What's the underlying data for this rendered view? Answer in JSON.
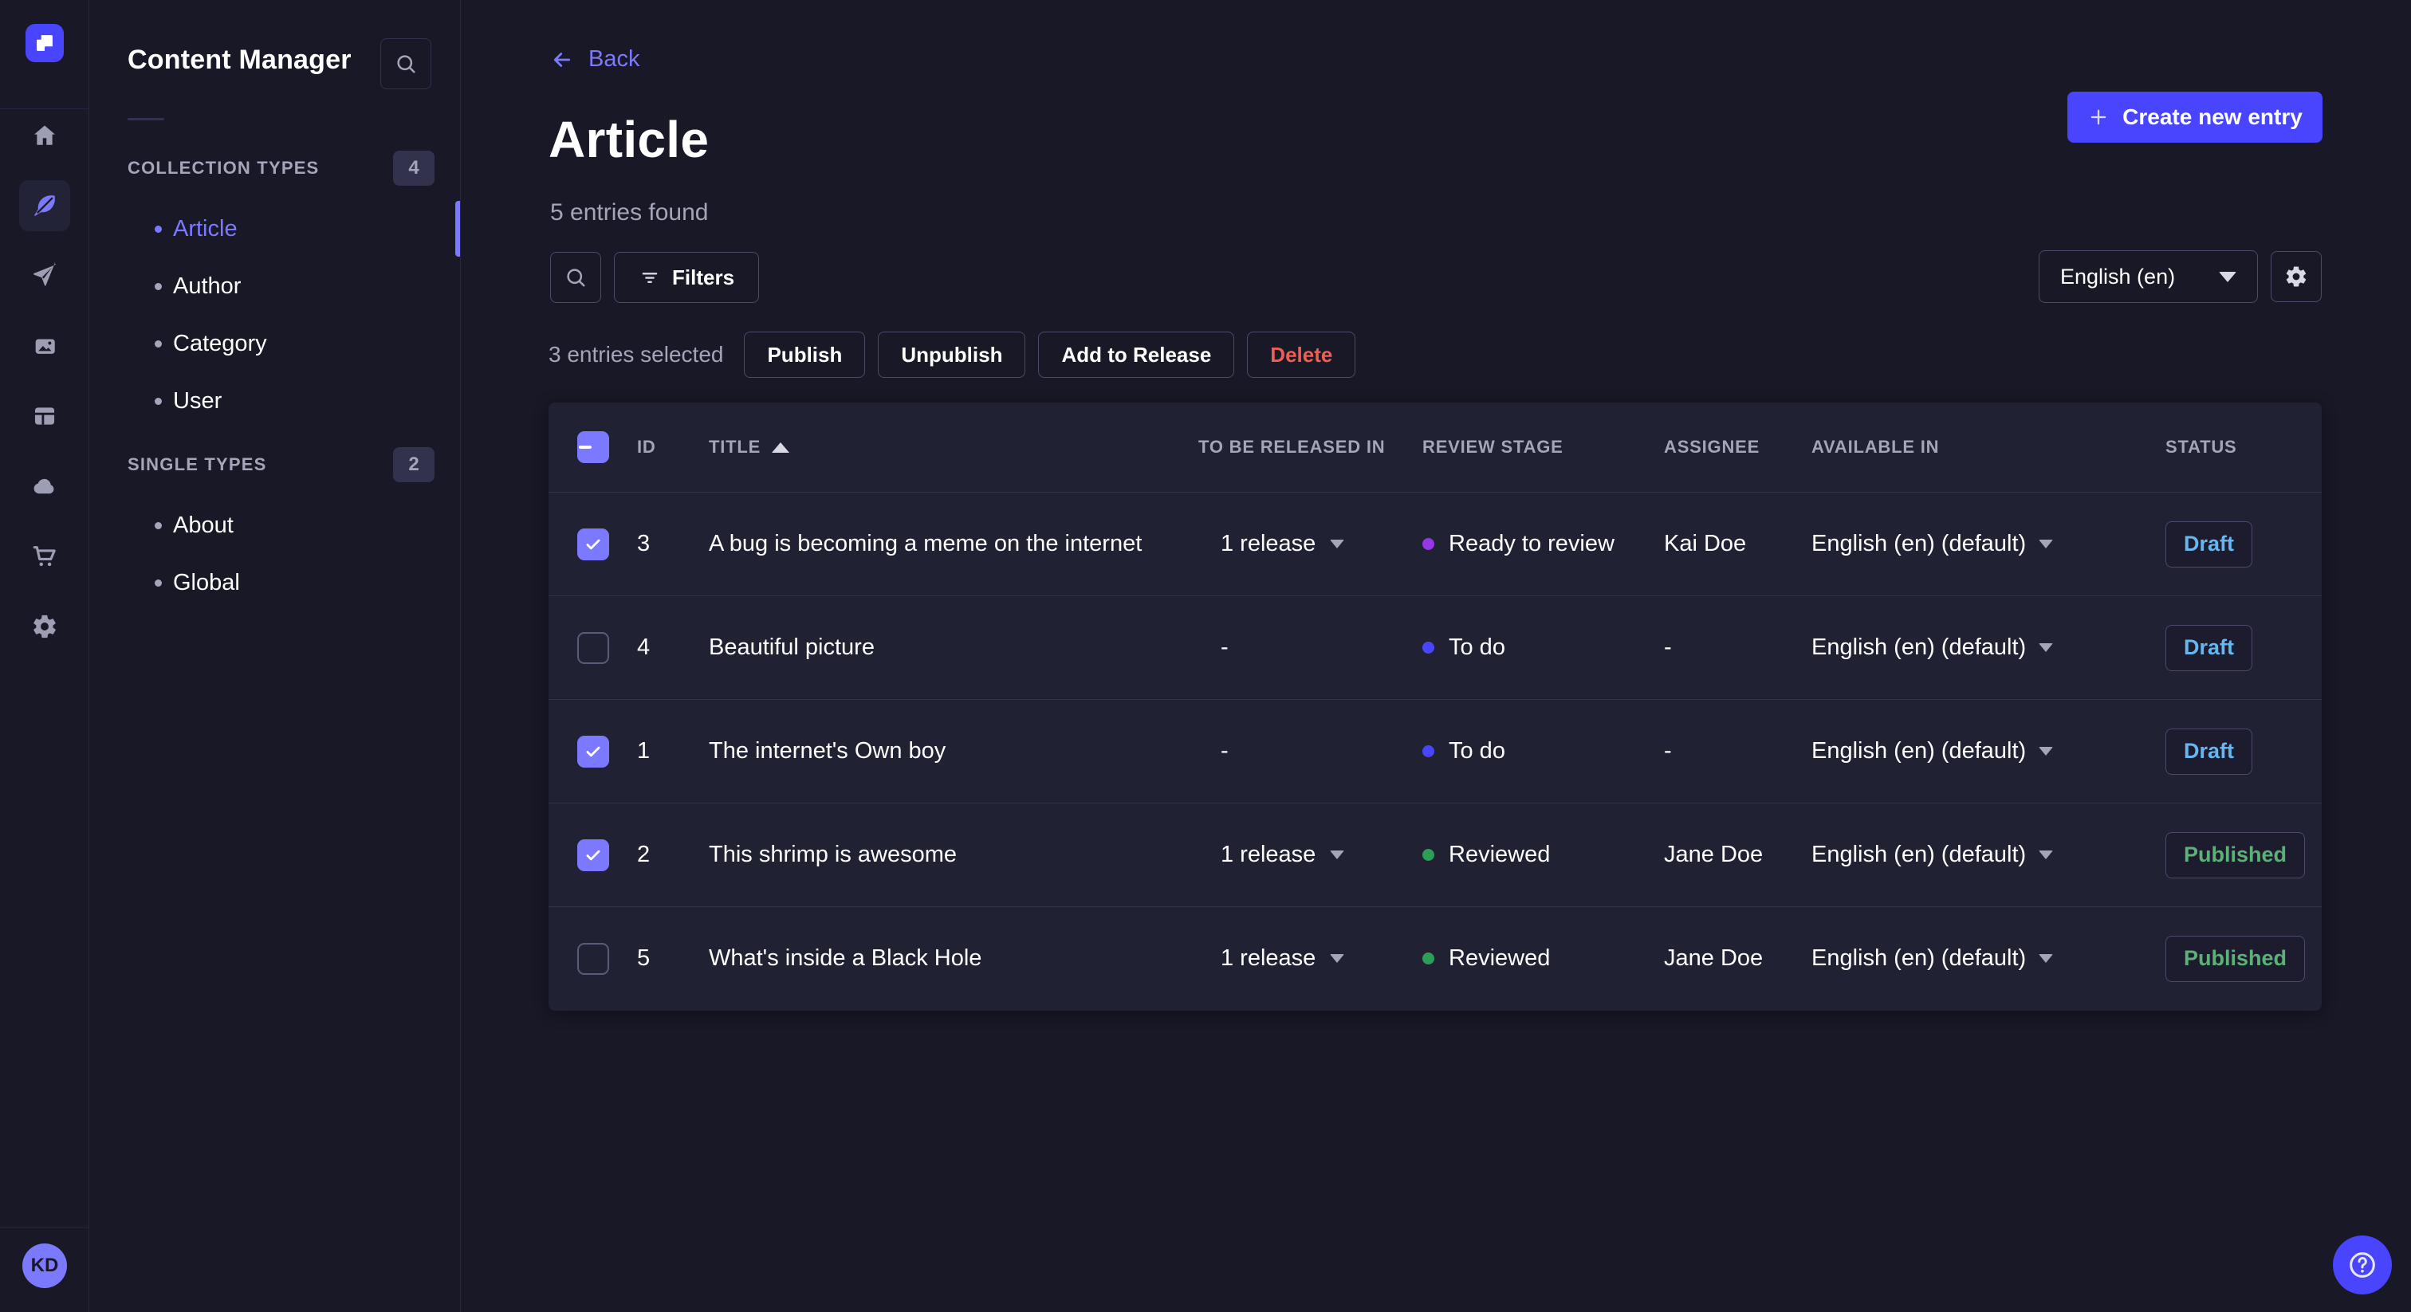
{
  "colors": {
    "page_bg": "#181826",
    "panel_bg": "#212134",
    "rail_border": "#26263e",
    "row_border": "#32324d",
    "border_strong": "#4a4a6a",
    "text": "#ffffff",
    "muted": "#a5a5ba",
    "icon": "#9d9db3",
    "primary": "#4945ff",
    "primary_light": "#7b79ff",
    "danger": "#ee5e52",
    "draft": "#66b7f1",
    "published": "#5cb176",
    "count_badge_bg": "#32324d",
    "badge_bg": "#1c1c2e",
    "active_pill": "#232338"
  },
  "nav_rail": {
    "icons": [
      "home",
      "content-manager",
      "releases",
      "media-library",
      "content-type-builder",
      "deploy",
      "marketplace",
      "settings"
    ],
    "active_icon": "content-manager",
    "avatar_initials": "KD"
  },
  "sidebar": {
    "title": "Content Manager",
    "sections": [
      {
        "label": "COLLECTION TYPES",
        "count": "4",
        "items": [
          {
            "label": "Article",
            "active": true
          },
          {
            "label": "Author",
            "active": false
          },
          {
            "label": "Category",
            "active": false
          },
          {
            "label": "User",
            "active": false
          }
        ]
      },
      {
        "label": "SINGLE TYPES",
        "count": "2",
        "items": [
          {
            "label": "About",
            "active": false
          },
          {
            "label": "Global",
            "active": false
          }
        ]
      }
    ]
  },
  "header": {
    "back_label": "Back",
    "title": "Article",
    "subtitle": "5 entries found",
    "create_button_label": "Create new entry"
  },
  "toolbar": {
    "filters_label": "Filters",
    "locale_value": "English (en)"
  },
  "selection": {
    "text": "3 entries selected",
    "actions": [
      {
        "label": "Publish",
        "danger": false
      },
      {
        "label": "Unpublish",
        "danger": false
      },
      {
        "label": "Add to Release",
        "danger": false
      },
      {
        "label": "Delete",
        "danger": true
      }
    ]
  },
  "table": {
    "columns": [
      "ID",
      "TITLE",
      "TO BE RELEASED IN",
      "REVIEW STAGE",
      "ASSIGNEE",
      "AVAILABLE IN",
      "STATUS"
    ],
    "sorted_column": "TITLE",
    "sort_direction": "asc",
    "header_checkbox_state": "indeterminate",
    "rows": [
      {
        "checked": true,
        "id": "3",
        "title": "A bug is becoming a meme on the internet",
        "release": "1 release",
        "stage": "Ready to review",
        "stage_color": "#9736e8",
        "assignee": "Kai Doe",
        "locale": "English (en) (default)",
        "status": "Draft"
      },
      {
        "checked": false,
        "id": "4",
        "title": "Beautiful picture",
        "release": "-",
        "stage": "To do",
        "stage_color": "#4945ff",
        "assignee": "-",
        "locale": "English (en) (default)",
        "status": "Draft"
      },
      {
        "checked": true,
        "id": "1",
        "title": "The internet's Own boy",
        "release": "-",
        "stage": "To do",
        "stage_color": "#4945ff",
        "assignee": "-",
        "locale": "English (en) (default)",
        "status": "Draft"
      },
      {
        "checked": true,
        "id": "2",
        "title": "This shrimp is awesome",
        "release": "1 release",
        "stage": "Reviewed",
        "stage_color": "#2d9e56",
        "assignee": "Jane Doe",
        "locale": "English (en) (default)",
        "status": "Published"
      },
      {
        "checked": false,
        "id": "5",
        "title": "What's inside a Black Hole",
        "release": "1 release",
        "stage": "Reviewed",
        "stage_color": "#2d9e56",
        "assignee": "Jane Doe",
        "locale": "English (en) (default)",
        "status": "Published"
      }
    ]
  }
}
